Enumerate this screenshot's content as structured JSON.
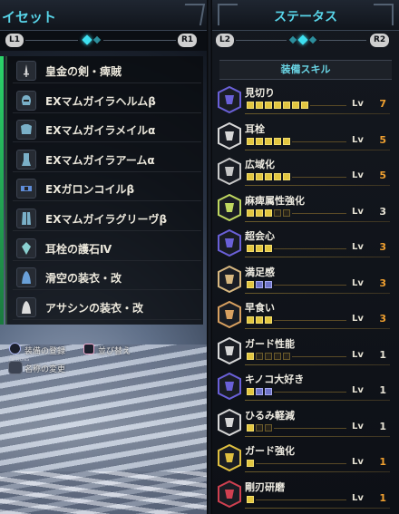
{
  "equipment_panel": {
    "title": "イセット",
    "nav": {
      "left_button": "L1",
      "right_button": "R1"
    },
    "items": [
      {
        "name": "皇金の剣・痺賊",
        "icon": "sword-icon",
        "icon_color": "#d8d8d8"
      },
      {
        "name": "EXマムガイラヘルムβ",
        "icon": "helm-icon",
        "icon_color": "#7ab0c8"
      },
      {
        "name": "EXマムガイラメイルα",
        "icon": "chest-icon",
        "icon_color": "#7ab0c8"
      },
      {
        "name": "EXマムガイラアームα",
        "icon": "arm-icon",
        "icon_color": "#7ab0c8"
      },
      {
        "name": "EXガロンコイルβ",
        "icon": "waist-icon",
        "icon_color": "#5e8cd8"
      },
      {
        "name": "EXマムガイラグリーヴβ",
        "icon": "leg-icon",
        "icon_color": "#7ab0c8"
      },
      {
        "name": "耳栓の護石Ⅳ",
        "icon": "charm-icon",
        "icon_color": "#8ad0d0"
      },
      {
        "name": "滑空の装衣・改",
        "icon": "mantle-icon",
        "icon_color": "#6aa0d8"
      },
      {
        "name": "アサシンの装衣・改",
        "icon": "mantle-icon",
        "icon_color": "#dcdcdc"
      }
    ]
  },
  "controls": {
    "register": "装備の登録",
    "sort": "並び替え",
    "rename": "名称の変更",
    "options_text": "OPTIONS"
  },
  "status_panel": {
    "title": "ステータス",
    "nav": {
      "left_button": "L2",
      "right_button": "R2"
    },
    "section_title": "装備スキル",
    "level_prefix": "Lv",
    "skills": [
      {
        "name": "見切り",
        "level": "7",
        "max": 7,
        "filled": 7,
        "slotted": 0,
        "icon_color": "#6a60d8",
        "level_color": "#f0a030"
      },
      {
        "name": "耳栓",
        "level": "5",
        "max": 5,
        "filled": 5,
        "slotted": 0,
        "icon_color": "#d8d8d8",
        "level_color": "#f0a030"
      },
      {
        "name": "広域化",
        "level": "5",
        "max": 5,
        "filled": 5,
        "slotted": 0,
        "icon_color": "#c8c8c8",
        "level_color": "#f0a030"
      },
      {
        "name": "麻痺属性強化",
        "level": "3",
        "max": 5,
        "filled": 3,
        "slotted": 0,
        "icon_color": "#c0d860",
        "level_color": "#e8e4d6"
      },
      {
        "name": "超会心",
        "level": "3",
        "max": 3,
        "filled": 3,
        "slotted": 0,
        "icon_color": "#6a60d8",
        "level_color": "#f0a030"
      },
      {
        "name": "満足感",
        "level": "3",
        "max": 3,
        "filled": 1,
        "slotted": 2,
        "icon_color": "#d8b880",
        "level_color": "#f0a030"
      },
      {
        "name": "早食い",
        "level": "3",
        "max": 3,
        "filled": 3,
        "slotted": 0,
        "icon_color": "#d8a060",
        "level_color": "#f0a030"
      },
      {
        "name": "ガード性能",
        "level": "1",
        "max": 5,
        "filled": 1,
        "slotted": 0,
        "icon_color": "#d8d8d8",
        "level_color": "#e8e4d6"
      },
      {
        "name": "キノコ大好き",
        "level": "1",
        "max": 3,
        "filled": 1,
        "slotted": 2,
        "icon_color": "#6a60d8",
        "level_color": "#e8e4d6"
      },
      {
        "name": "ひるみ軽減",
        "level": "1",
        "max": 3,
        "filled": 1,
        "slotted": 0,
        "icon_color": "#d8d8d8",
        "level_color": "#e8e4d6"
      },
      {
        "name": "ガード強化",
        "level": "1",
        "max": 1,
        "filled": 1,
        "slotted": 0,
        "icon_color": "#e0c040",
        "level_color": "#f0a030"
      },
      {
        "name": "剛刃研磨",
        "level": "1",
        "max": 1,
        "filled": 1,
        "slotted": 0,
        "icon_color": "#d04050",
        "level_color": "#f0a030"
      }
    ]
  },
  "colors": {
    "accent_cyan": "#58d4e8",
    "pip_gold": "#e2c640",
    "max_level_orange": "#f0a030",
    "equipment_marker_green": "#2bd46a"
  }
}
